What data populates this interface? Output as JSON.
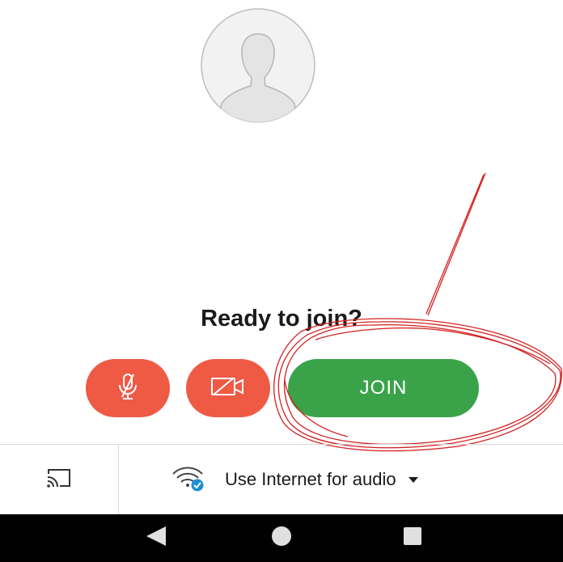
{
  "app": {
    "avatar_icon": "default-user-avatar-icon"
  },
  "prejoin": {
    "title": "Ready to join?",
    "mic_button": {
      "icon": "mic-off-icon",
      "state": "muted"
    },
    "camera_button": {
      "icon": "camera-off-icon",
      "state": "off"
    },
    "join_label": "JOIN"
  },
  "bottom_bar": {
    "cast_icon": "cast-icon",
    "audio_icon": "wifi-audio-check-icon",
    "audio_label": "Use Internet for audio",
    "audio_caret_icon": "caret-down-icon"
  },
  "navigation": {
    "back_icon": "back-triangle-icon",
    "home_icon": "home-circle-icon",
    "recent_icon": "recent-apps-square-icon"
  },
  "colors": {
    "mute_buttons": "#ef5a45",
    "join_button": "#3aa34a",
    "annotation": "#d32020",
    "nav_bar": "#000000"
  }
}
